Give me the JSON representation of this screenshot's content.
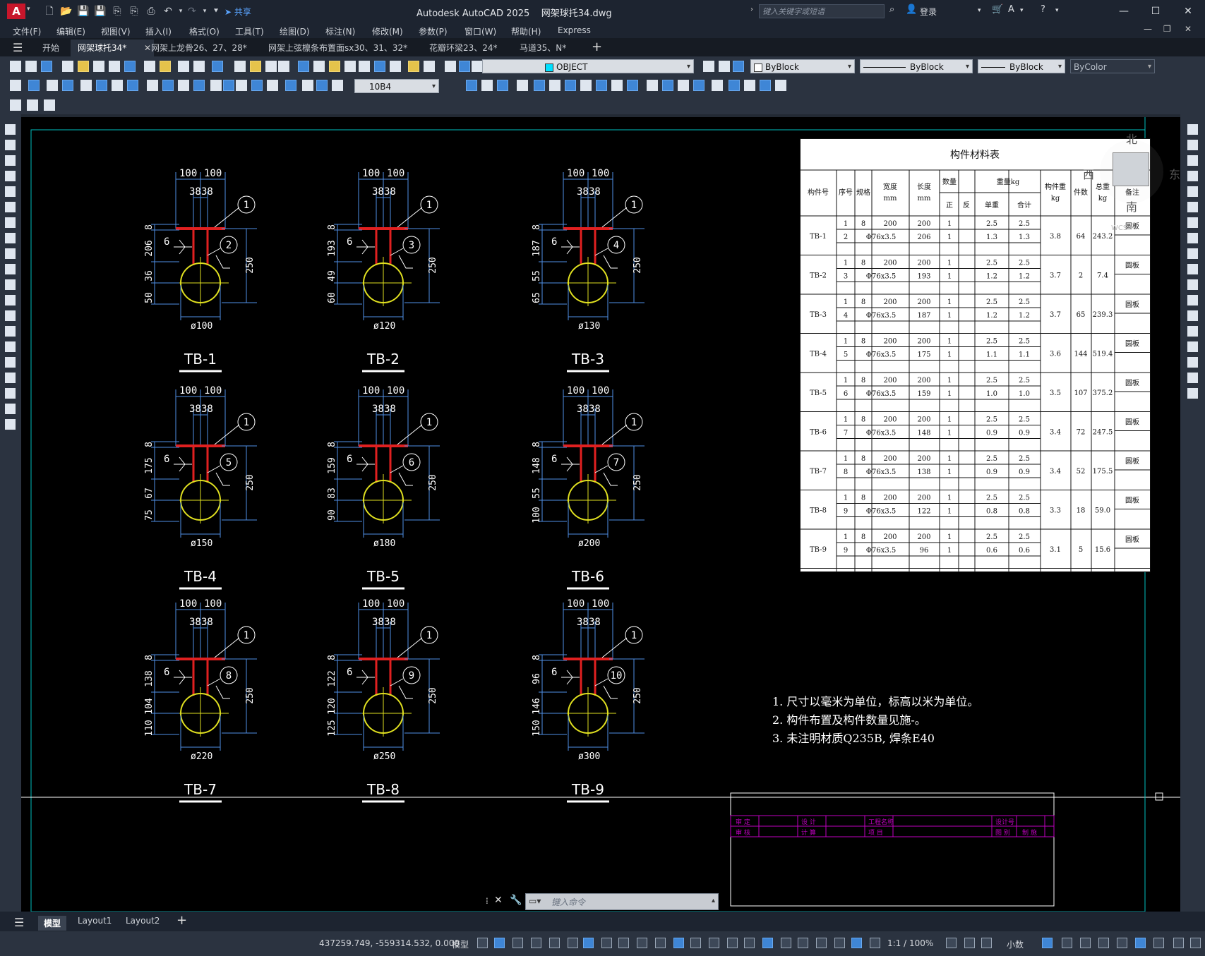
{
  "app": {
    "title": "Autodesk AutoCAD 2025",
    "filename": "网架球托34.dwg",
    "share_label": "共享",
    "search_placeholder": "键入关键字或短语",
    "login_label": "登录"
  },
  "menu": [
    "文件(F)",
    "编辑(E)",
    "视图(V)",
    "插入(I)",
    "格式(O)",
    "工具(T)",
    "绘图(D)",
    "标注(N)",
    "修改(M)",
    "参数(P)",
    "窗口(W)",
    "帮助(H)",
    "Express"
  ],
  "doc_tabs": [
    "开始",
    "网架球托34*",
    "网架上龙骨26、27、28*",
    "网架上弦檩条布置面sx30、31、32*",
    "花瓣环梁23、24*",
    "马道35、N*"
  ],
  "toolbar": {
    "layer_name": "OBJECT",
    "color": "ByBlock",
    "linetype": "ByBlock",
    "lineweight": "ByBlock",
    "plotstyle": "ByColor",
    "dimstyle": "10B4"
  },
  "drawing": {
    "details": [
      {
        "id": "TB-1",
        "top_dims": [
          "100",
          "100"
        ],
        "inner_dims": [
          "38",
          "38"
        ],
        "left_dims": [
          "8",
          "206",
          "36",
          "50"
        ],
        "height": "250",
        "dia": "ø100",
        "callout_top": "1",
        "callout_mid": "2",
        "weld": "6"
      },
      {
        "id": "TB-2",
        "top_dims": [
          "100",
          "100"
        ],
        "inner_dims": [
          "38",
          "38"
        ],
        "left_dims": [
          "8",
          "193",
          "49",
          "60"
        ],
        "height": "250",
        "dia": "ø120",
        "callout_top": "1",
        "callout_mid": "3",
        "weld": "6"
      },
      {
        "id": "TB-3",
        "top_dims": [
          "100",
          "100"
        ],
        "inner_dims": [
          "38",
          "38"
        ],
        "left_dims": [
          "8",
          "187",
          "55",
          "65"
        ],
        "height": "250",
        "dia": "ø130",
        "callout_top": "1",
        "callout_mid": "4",
        "weld": "6"
      },
      {
        "id": "TB-4",
        "top_dims": [
          "100",
          "100"
        ],
        "inner_dims": [
          "38",
          "38"
        ],
        "left_dims": [
          "8",
          "175",
          "67",
          "75"
        ],
        "height": "250",
        "dia": "ø150",
        "callout_top": "1",
        "callout_mid": "5",
        "weld": "6"
      },
      {
        "id": "TB-5",
        "top_dims": [
          "100",
          "100"
        ],
        "inner_dims": [
          "38",
          "38"
        ],
        "left_dims": [
          "8",
          "159",
          "83",
          "90"
        ],
        "height": "250",
        "dia": "ø180",
        "callout_top": "1",
        "callout_mid": "6",
        "weld": "6"
      },
      {
        "id": "TB-6",
        "top_dims": [
          "100",
          "100"
        ],
        "inner_dims": [
          "38",
          "38"
        ],
        "left_dims": [
          "8",
          "148",
          "55",
          "100"
        ],
        "height": "250",
        "dia": "ø200",
        "callout_top": "1",
        "callout_mid": "7",
        "weld": "6"
      },
      {
        "id": "TB-7",
        "top_dims": [
          "100",
          "100"
        ],
        "inner_dims": [
          "38",
          "38"
        ],
        "left_dims": [
          "8",
          "138",
          "104",
          "110"
        ],
        "height": "250",
        "dia": "ø220",
        "callout_top": "1",
        "callout_mid": "8",
        "weld": "6"
      },
      {
        "id": "TB-8",
        "top_dims": [
          "100",
          "100"
        ],
        "inner_dims": [
          "38",
          "38"
        ],
        "left_dims": [
          "8",
          "122",
          "120",
          "125"
        ],
        "height": "250",
        "dia": "ø250",
        "callout_top": "1",
        "callout_mid": "9",
        "weld": "6"
      },
      {
        "id": "TB-9",
        "top_dims": [
          "100",
          "100"
        ],
        "inner_dims": [
          "38",
          "38"
        ],
        "left_dims": [
          "8",
          "96",
          "146",
          "150"
        ],
        "height": "250",
        "dia": "ø300",
        "callout_top": "1",
        "callout_mid": "10",
        "weld": "6"
      }
    ],
    "notes": [
      "1. 尺寸以毫米为单位，标高以米为单位。",
      "2. 构件布置及构件数量见施-。",
      "3. 未注明材质Q235B, 焊条E40"
    ],
    "table": {
      "title": "构件材料表",
      "headers": {
        "part_no": "构件号",
        "seq": "序号",
        "spec": "规格",
        "width": "宽度",
        "width_unit": "mm",
        "length": "长度",
        "length_unit": "mm",
        "qty": "数量",
        "qty_pos": "正",
        "qty_neg": "反",
        "weight": "重量kg",
        "unit_wt": "单重",
        "total_wt": "合计",
        "part_wt": "构件重",
        "part_wt_unit": "kg",
        "pieces": "件数",
        "grand": "总重",
        "grand_unit": "kg",
        "remark": "备注"
      },
      "rows": [
        {
          "part": "TB-1",
          "r1": [
            "1",
            "8",
            "200",
            "200",
            "1",
            "",
            "2.5",
            "2.5"
          ],
          "r2": [
            "2",
            "Φ76x3.5",
            "206",
            "1",
            "",
            "1.3",
            "1.3"
          ],
          "part_wt": "3.8",
          "pieces": "64",
          "total": "243.2",
          "remark": "圆板"
        },
        {
          "part": "TB-2",
          "r1": [
            "1",
            "8",
            "200",
            "200",
            "1",
            "",
            "2.5",
            "2.5"
          ],
          "r2": [
            "3",
            "Φ76x3.5",
            "193",
            "1",
            "",
            "1.2",
            "1.2"
          ],
          "part_wt": "3.7",
          "pieces": "2",
          "total": "7.4",
          "remark": "圆板"
        },
        {
          "part": "TB-3",
          "r1": [
            "1",
            "8",
            "200",
            "200",
            "1",
            "",
            "2.5",
            "2.5"
          ],
          "r2": [
            "4",
            "Φ76x3.5",
            "187",
            "1",
            "",
            "1.2",
            "1.2"
          ],
          "part_wt": "3.7",
          "pieces": "65",
          "total": "239.3",
          "remark": "圆板"
        },
        {
          "part": "TB-4",
          "r1": [
            "1",
            "8",
            "200",
            "200",
            "1",
            "",
            "2.5",
            "2.5"
          ],
          "r2": [
            "5",
            "Φ76x3.5",
            "175",
            "1",
            "",
            "1.1",
            "1.1"
          ],
          "part_wt": "3.6",
          "pieces": "144",
          "total": "519.4",
          "remark": "圆板"
        },
        {
          "part": "TB-5",
          "r1": [
            "1",
            "8",
            "200",
            "200",
            "1",
            "",
            "2.5",
            "2.5"
          ],
          "r2": [
            "6",
            "Φ76x3.5",
            "159",
            "1",
            "",
            "1.0",
            "1.0"
          ],
          "part_wt": "3.5",
          "pieces": "107",
          "total": "375.2",
          "remark": "圆板"
        },
        {
          "part": "TB-6",
          "r1": [
            "1",
            "8",
            "200",
            "200",
            "1",
            "",
            "2.5",
            "2.5"
          ],
          "r2": [
            "7",
            "Φ76x3.5",
            "148",
            "1",
            "",
            "0.9",
            "0.9"
          ],
          "part_wt": "3.4",
          "pieces": "72",
          "total": "247.5",
          "remark": "圆板"
        },
        {
          "part": "TB-7",
          "r1": [
            "1",
            "8",
            "200",
            "200",
            "1",
            "",
            "2.5",
            "2.5"
          ],
          "r2": [
            "8",
            "Φ76x3.5",
            "138",
            "1",
            "",
            "0.9",
            "0.9"
          ],
          "part_wt": "3.4",
          "pieces": "52",
          "total": "175.5",
          "remark": "圆板"
        },
        {
          "part": "TB-8",
          "r1": [
            "1",
            "8",
            "200",
            "200",
            "1",
            "",
            "2.5",
            "2.5"
          ],
          "r2": [
            "9",
            "Φ76x3.5",
            "122",
            "1",
            "",
            "0.8",
            "0.8"
          ],
          "part_wt": "3.3",
          "pieces": "18",
          "total": "59.0",
          "remark": "圆板"
        },
        {
          "part": "TB-9",
          "r1": [
            "1",
            "8",
            "200",
            "200",
            "1",
            "",
            "2.5",
            "2.5"
          ],
          "r2": [
            "9",
            "Φ76x3.5",
            "96",
            "1",
            "",
            "0.6",
            "0.6"
          ],
          "part_wt": "3.1",
          "pieces": "5",
          "total": "15.6",
          "remark": "圆板"
        }
      ]
    },
    "titleblock": [
      "审 定",
      "设 计",
      "工程名称",
      "设计号",
      "审 核",
      "计 算",
      "项 目",
      "图 别",
      "制 施"
    ],
    "viewcube": {
      "north": "北",
      "west": "西",
      "east": "东",
      "south": "南",
      "wcs": "WCS"
    }
  },
  "layout_tabs": [
    "模型",
    "Layout1",
    "Layout2"
  ],
  "command_placeholder": "键入命令",
  "status": {
    "coords": "437259.749, -559314.532, 0.000",
    "model": "模型",
    "scale": "1:1 / 100%",
    "units": "小数"
  },
  "colors": {
    "background": "#222933",
    "canvas": "#000000",
    "dimension": "#4f8fe6",
    "plate": "#e02020",
    "ball": "#e0e020",
    "frame": "#00c0c0",
    "titleblock": "#c000c0"
  }
}
